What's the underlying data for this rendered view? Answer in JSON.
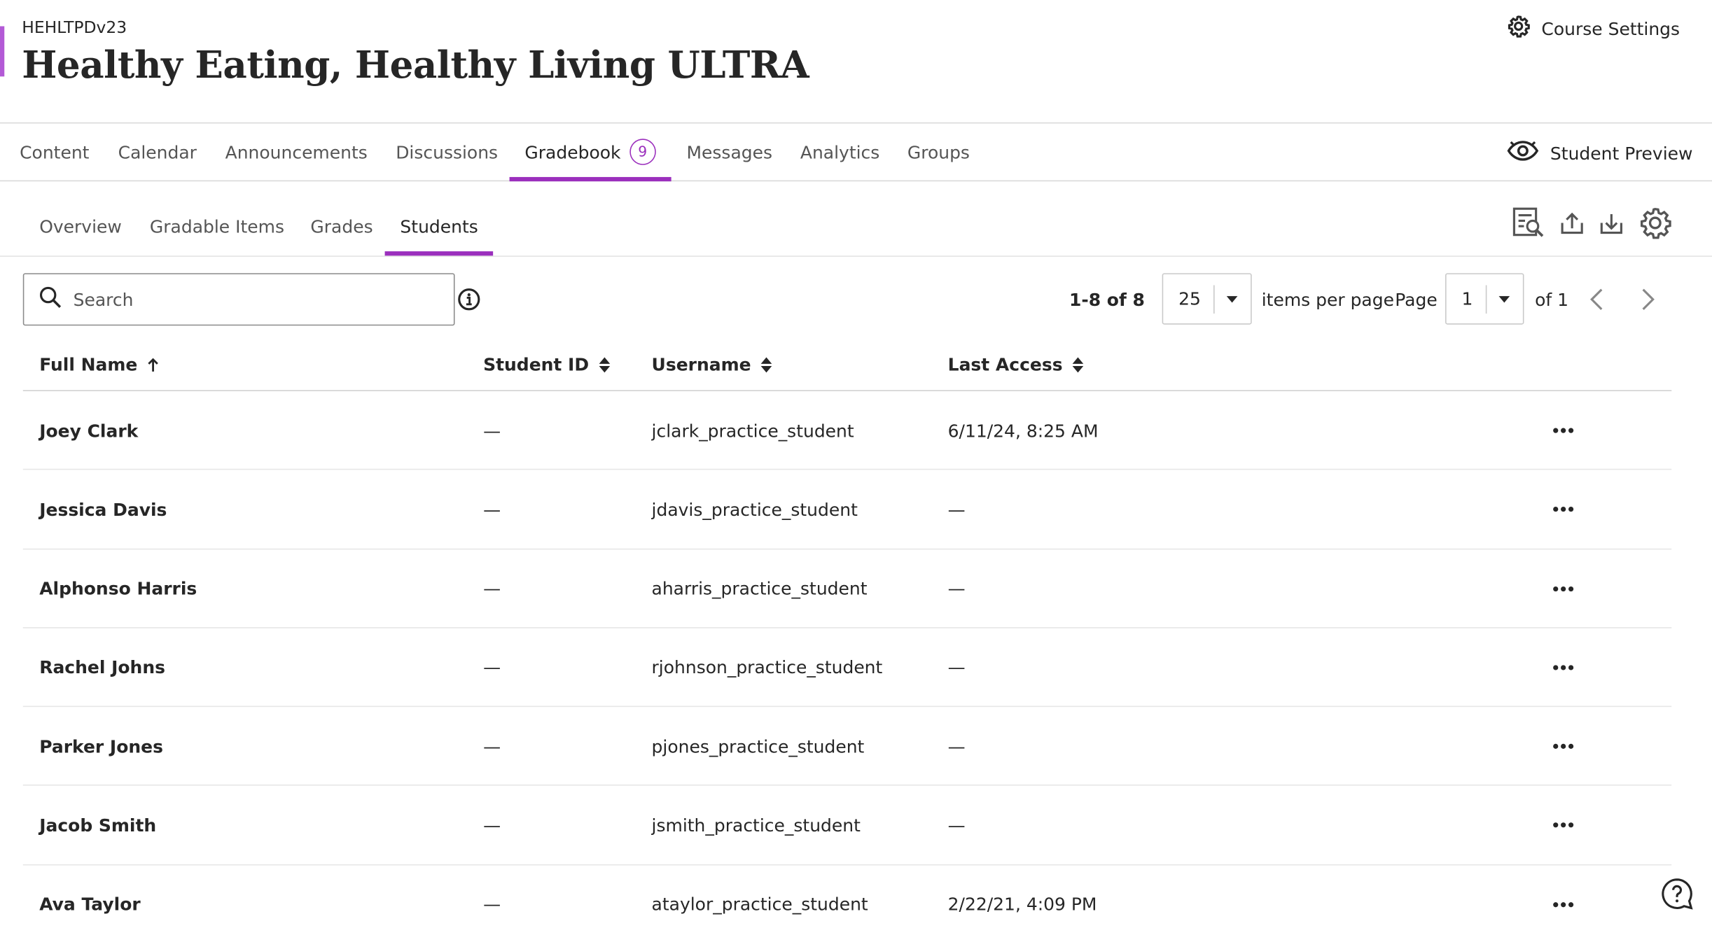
{
  "course": {
    "code": "HEHLTPDv23",
    "title": "Healthy Eating, Healthy Living ULTRA",
    "settings_label": "Course Settings"
  },
  "top_nav": {
    "tabs": [
      {
        "label": "Content"
      },
      {
        "label": "Calendar"
      },
      {
        "label": "Announcements"
      },
      {
        "label": "Discussions"
      },
      {
        "label": "Gradebook",
        "badge": "9",
        "active": true
      },
      {
        "label": "Messages"
      },
      {
        "label": "Analytics"
      },
      {
        "label": "Groups"
      }
    ],
    "student_preview_label": "Student Preview"
  },
  "sub_nav": {
    "tabs": [
      {
        "label": "Overview"
      },
      {
        "label": "Gradable Items"
      },
      {
        "label": "Grades"
      },
      {
        "label": "Students",
        "active": true
      }
    ],
    "tools": [
      "search-report-icon",
      "upload-icon",
      "download-icon",
      "settings-gear-icon"
    ]
  },
  "search": {
    "placeholder": "Search"
  },
  "pagination": {
    "range": "1-8 of 8",
    "per_page": "25",
    "per_page_label": "items per page",
    "page_label": "Page",
    "page": "1",
    "of_label": "of 1"
  },
  "table": {
    "columns": [
      "Full Name",
      "Student ID",
      "Username",
      "Last Access"
    ],
    "rows": [
      {
        "name": "Joey Clark",
        "student_id": "—",
        "username": "jclark_practice_student",
        "last_access": "6/11/24, 8:25 AM"
      },
      {
        "name": "Jessica Davis",
        "student_id": "—",
        "username": "jdavis_practice_student",
        "last_access": "—"
      },
      {
        "name": "Alphonso Harris",
        "student_id": "—",
        "username": "aharris_practice_student",
        "last_access": "—"
      },
      {
        "name": "Rachel Johns",
        "student_id": "—",
        "username": "rjohnson_practice_student",
        "last_access": "—"
      },
      {
        "name": "Parker Jones",
        "student_id": "—",
        "username": "pjones_practice_student",
        "last_access": "—"
      },
      {
        "name": "Jacob Smith",
        "student_id": "—",
        "username": "jsmith_practice_student",
        "last_access": "—"
      },
      {
        "name": "Ava Taylor",
        "student_id": "—",
        "username": "ataylor_practice_student",
        "last_access": "2/22/21, 4:09 PM"
      }
    ]
  },
  "colors": {
    "accent": "#9b2fbd",
    "accent_bar": "#b35ad6",
    "text": "#262626"
  }
}
